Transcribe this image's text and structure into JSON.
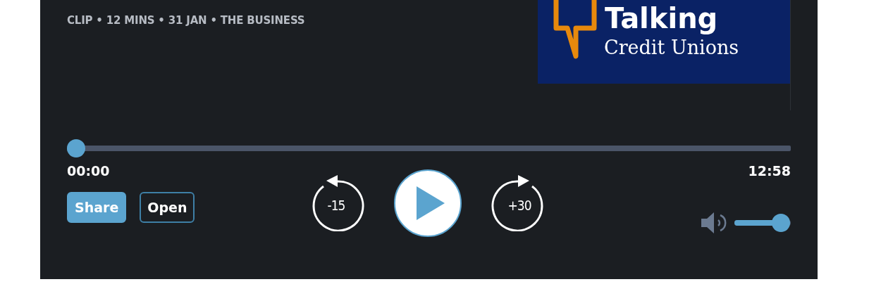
{
  "episode": {
    "meta": "CLIP • 12 MINS • 31 JAN • THE BUSINESS"
  },
  "artwork": {
    "title": "Talking",
    "subtitle": "Credit Unions"
  },
  "player": {
    "progress": {
      "level": 0
    },
    "elapsed": "00:00",
    "duration": "12:58",
    "buttons": [
      {
        "label": "Share",
        "kind": "filled"
      },
      {
        "label": "Open",
        "kind": "outline"
      }
    ],
    "skip_back": "-15",
    "skip_forward": "+30",
    "playing": false,
    "volume": {
      "level": 0.82
    }
  }
}
